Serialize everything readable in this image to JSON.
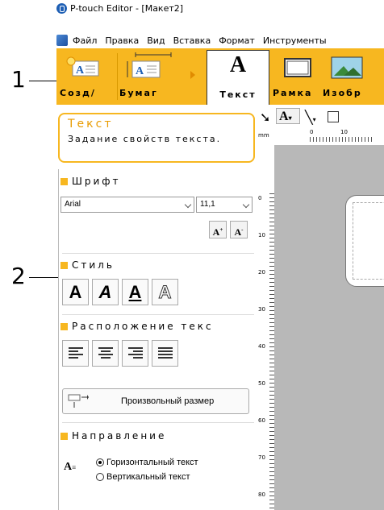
{
  "window": {
    "title": "P-touch Editor - [Макет2]"
  },
  "menu": [
    "Файл",
    "Правка",
    "Вид",
    "Вставка",
    "Формат",
    "Инструменты"
  ],
  "toolbar": {
    "create": "Созд/",
    "paper": "Бумаг",
    "text": "Текст",
    "frame": "Рамка",
    "image": "Изобр"
  },
  "callouts": {
    "one": "1",
    "two": "2"
  },
  "panel": {
    "title": "Текст",
    "description": "Задание свойств текста.",
    "font": {
      "heading": "Шрифт",
      "family": "Arial",
      "size": "11,1"
    },
    "style": {
      "heading": "Стиль"
    },
    "layout": {
      "heading": "Расположение текс",
      "free_size": "Произвольный размер"
    },
    "direction": {
      "heading": "Направление",
      "horizontal": "Горизонтальный текст",
      "vertical": "Вертикальный текст",
      "selected": "horizontal"
    }
  },
  "ruler": {
    "unit": "mm",
    "marks": [
      "0",
      "10",
      "20",
      "30",
      "40",
      "50",
      "60",
      "70",
      "80"
    ]
  },
  "colors": {
    "accent": "#f7b720",
    "panel_title": "#e89b00",
    "canvas": "#b8b8b8"
  }
}
